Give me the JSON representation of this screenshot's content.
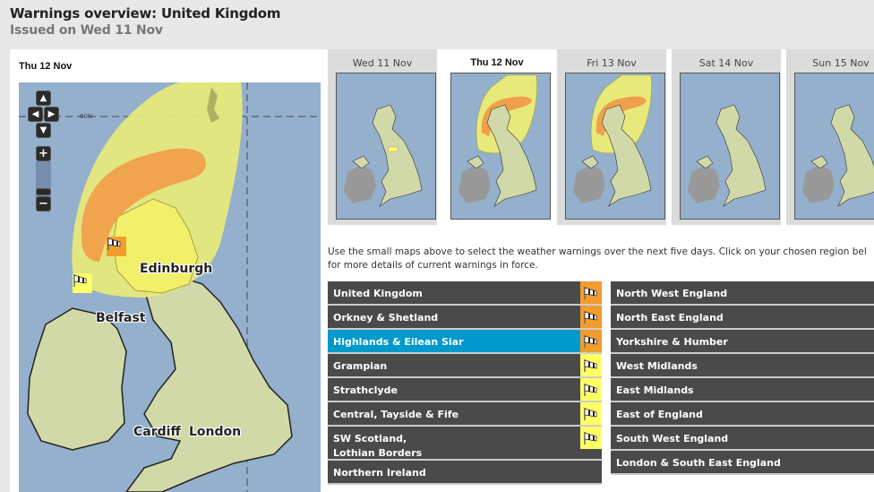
{
  "header": {
    "title": "Warnings overview: United Kingdom",
    "issued": "Issued on Wed 11 Nov"
  },
  "main_map": {
    "date": "Thu 12 Nov",
    "latitude_label": "60N",
    "cities": [
      "Edinburgh",
      "Belfast",
      "Cardiff",
      "London"
    ],
    "controls": {
      "pan_up": "▲",
      "pan_down": "▼",
      "pan_left": "◀",
      "pan_right": "▶",
      "zoom_in": "+",
      "zoom_out": "−"
    }
  },
  "days": [
    {
      "label": "Wed 11 Nov",
      "active": false,
      "warning": "yellow-small"
    },
    {
      "label": "Thu 12 Nov",
      "active": true,
      "warning": "amber-yellow"
    },
    {
      "label": "Fri 13 Nov",
      "active": false,
      "warning": "amber-yellow"
    },
    {
      "label": "Sat 14 Nov",
      "active": false,
      "warning": "none"
    },
    {
      "label": "Sun 15 Nov",
      "active": false,
      "warning": "none"
    }
  ],
  "intro": {
    "line1": "Use the small maps above to select the weather warnings over the next five days. Click on your chosen region bel",
    "line2": "for more details of current warnings in force."
  },
  "regions_left": [
    {
      "label": "United Kingdom",
      "warning": "amber",
      "icon": "wind-icon",
      "selected": false
    },
    {
      "label": "Orkney & Shetland",
      "warning": "amber",
      "icon": "wind-icon",
      "selected": false
    },
    {
      "label": "Highlands & Eilean Siar",
      "warning": "amber",
      "icon": "wind-icon",
      "selected": true
    },
    {
      "label": "Grampian",
      "warning": "yellow",
      "icon": "wind-icon",
      "selected": false
    },
    {
      "label": "Strathclyde",
      "warning": "yellow",
      "icon": "wind-icon",
      "selected": false
    },
    {
      "label": "Central, Tayside & Fife",
      "warning": "yellow",
      "icon": "wind-icon",
      "selected": false
    },
    {
      "label": "SW Scotland, Lothian Borders",
      "warning": "yellow",
      "icon": "wind-icon",
      "selected": false
    },
    {
      "label": "Northern Ireland",
      "warning": "none",
      "selected": false
    }
  ],
  "regions_right": [
    {
      "label": "North West England"
    },
    {
      "label": "North East England"
    },
    {
      "label": "Yorkshire & Humber"
    },
    {
      "label": "West Midlands"
    },
    {
      "label": "East Midlands"
    },
    {
      "label": "East of England"
    },
    {
      "label": "South West England"
    },
    {
      "label": "London & South East England"
    }
  ],
  "colors": {
    "amber": "#f39c2e",
    "yellow": "#ffff66",
    "selected": "#0099cc",
    "row": "#4a4a4a",
    "sea": "#94b0cc",
    "land": "#d2d9a8"
  }
}
